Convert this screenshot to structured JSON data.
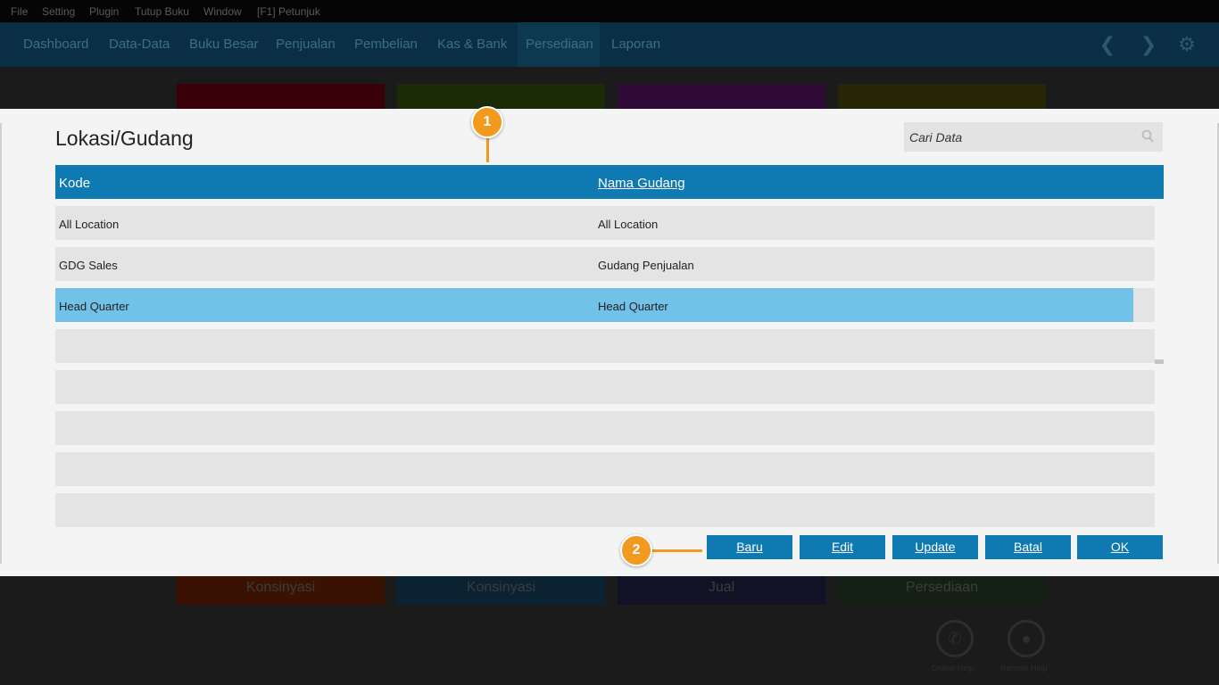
{
  "menu": [
    "File",
    "Setting",
    "Plugin",
    "Tutup Buku",
    "Window",
    "[F1] Petunjuk"
  ],
  "nav": [
    "Dashboard",
    "Data-Data",
    "Buku Besar",
    "Penjualan",
    "Pembelian",
    "Kas & Bank",
    "Persediaan",
    "Laporan"
  ],
  "tiles": [
    "Konsinyasi",
    "Konsinyasi",
    "Jual",
    "Persediaan"
  ],
  "bottom_links": [
    "Online Help",
    "Remote Help"
  ],
  "dialog": {
    "title": "Lokasi/Gudang",
    "search_placeholder": "Cari Data",
    "columns": [
      "Kode",
      "Nama Gudang"
    ],
    "rows": [
      {
        "kode": "All Location",
        "nama": "All Location"
      },
      {
        "kode": "GDG Sales",
        "nama": "Gudang Penjualan"
      },
      {
        "kode": "Head Quarter",
        "nama": "Head Quarter"
      }
    ],
    "selected_row": 2,
    "buttons": [
      "Baru",
      "Edit",
      "Update",
      "Batal",
      "OK"
    ]
  },
  "callouts": [
    "1",
    "2"
  ],
  "colors": {
    "accent": "#0f79b2",
    "selection": "#71c1e8",
    "callout": "#f39a1e",
    "tiles": [
      "#3a0008",
      "#1b2b05",
      "#2f0a36",
      "#262606"
    ]
  }
}
